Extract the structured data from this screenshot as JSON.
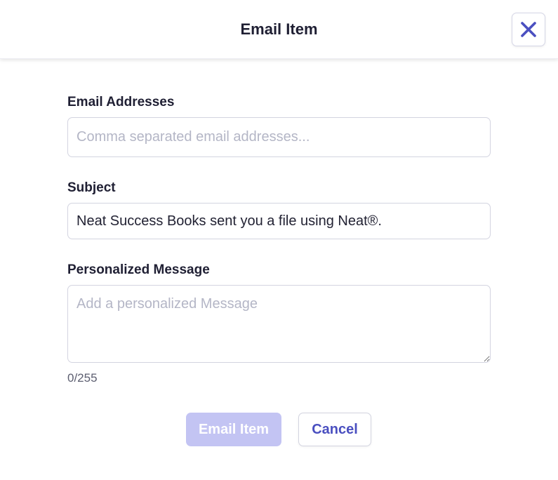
{
  "dialog": {
    "title": "Email Item",
    "close_icon": "close-x-icon",
    "accent_color": "#4a4fc0"
  },
  "form": {
    "email": {
      "label": "Email Addresses",
      "value": "",
      "placeholder": "Comma separated email addresses..."
    },
    "subject": {
      "label": "Subject",
      "value": "Neat Success Books sent you a file using Neat®.",
      "placeholder": ""
    },
    "message": {
      "label": "Personalized Message",
      "value": "",
      "placeholder": "Add a personalized Message",
      "counter": "0/255"
    }
  },
  "actions": {
    "submit_label": "Email Item",
    "submit_disabled": true,
    "cancel_label": "Cancel"
  }
}
